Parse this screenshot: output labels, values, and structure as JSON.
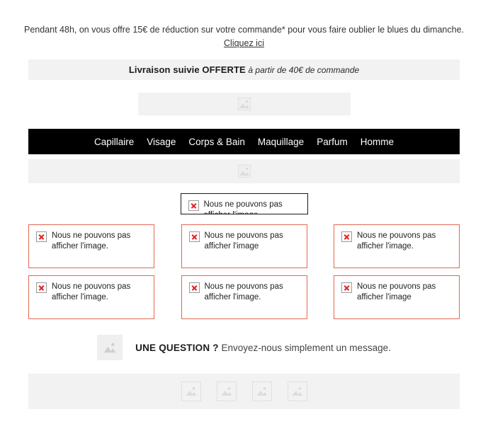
{
  "promo": {
    "headline": "Pendant 48h, on vous offre 15€ de réduction sur votre commande* pour vous faire oublier le blues du dimanche.",
    "link_label": "Cliquez ici"
  },
  "shipping": {
    "bold": "Livraison suivie OFFERTE",
    "italic": "à partir de 40€ de commande"
  },
  "logo": {
    "icon": "image-placeholder-icon"
  },
  "nav": {
    "items": [
      {
        "label": "Capillaire"
      },
      {
        "label": "Visage"
      },
      {
        "label": "Corps & Bain"
      },
      {
        "label": "Maquillage"
      },
      {
        "label": "Parfum"
      },
      {
        "label": "Homme"
      }
    ]
  },
  "sub_strip": {
    "icon": "image-placeholder-icon"
  },
  "hero": {
    "broken_text": "Nous ne pouvons pas afficher l'image.",
    "icon": "broken-image-icon"
  },
  "grid": {
    "cells": [
      {
        "text": "Nous ne pouvons pas afficher l'image."
      },
      {
        "text": "Nous ne pouvons pas afficher l'image"
      },
      {
        "text": "Nous ne pouvons pas afficher l'image."
      },
      {
        "text": "Nous ne pouvons pas afficher l'image."
      },
      {
        "text": "Nous ne pouvons pas afficher l'image."
      },
      {
        "text": "Nous ne pouvons pas afficher l'image"
      }
    ]
  },
  "question": {
    "icon": "image-placeholder-icon",
    "bold": "UNE QUESTION ?",
    "rest": " Envoyez-nous simplement un message."
  },
  "footer": {
    "social": [
      {
        "icon": "image-placeholder-icon"
      },
      {
        "icon": "image-placeholder-icon"
      },
      {
        "icon": "image-placeholder-icon"
      },
      {
        "icon": "image-placeholder-icon"
      }
    ]
  },
  "colors": {
    "nav_background": "#000000",
    "band_background": "#f2f2f2",
    "broken_border": "#e2684f",
    "hero_broken_border": "#1a1a1a",
    "x_mark": "#e02020"
  }
}
